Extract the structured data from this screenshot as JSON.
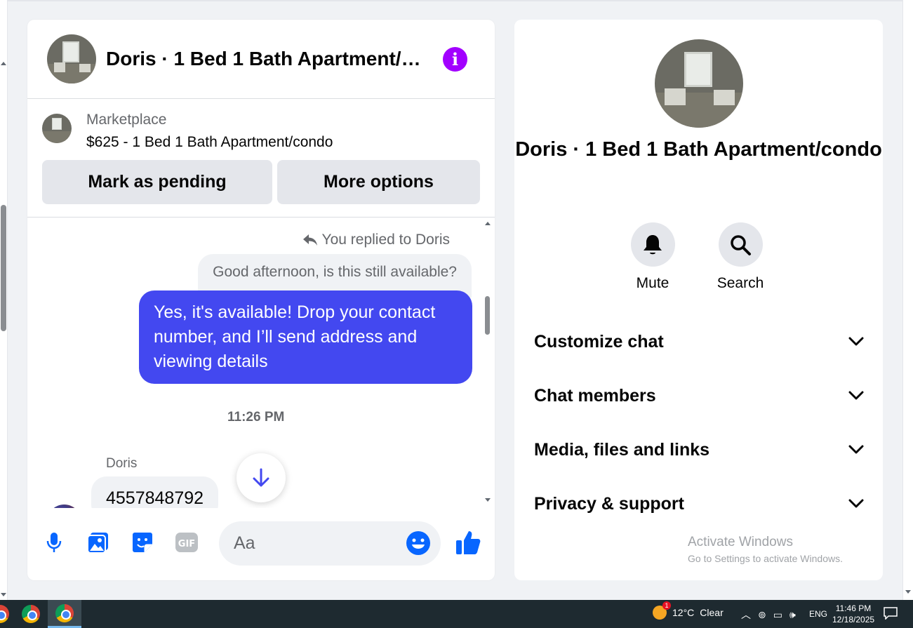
{
  "chat": {
    "title": "Doris · 1 Bed 1 Bath Apartment/condo",
    "marketplace": {
      "label": "Marketplace",
      "listing": "$625 - 1 Bed 1 Bath Apartment/condo",
      "mark_pending": "Mark as pending",
      "more_options": "More options"
    },
    "messages": {
      "replied_note": "You replied to Doris",
      "quoted": "Good afternoon, is this still available?",
      "mine": "Yes, it's available! Drop your contact number, and I’ll send address and viewing details",
      "timestamp": "11:26 PM",
      "sender": "Doris",
      "theirs": "4557848792"
    },
    "composer": {
      "placeholder": "Aa",
      "icons": [
        "microphone-icon",
        "photo-icon",
        "sticker-icon",
        "gif-icon",
        "emoji-icon",
        "thumbs-up-icon"
      ]
    },
    "accent_color": "#4348f0",
    "brand_color": "#0866ff"
  },
  "info": {
    "name": "Doris · 1 Bed 1 Bath Apartment/condo",
    "actions": {
      "mute": "Mute",
      "search": "Search"
    },
    "sections": [
      "Customize chat",
      "Chat members",
      "Media, files and links",
      "Privacy & support"
    ],
    "watermark": {
      "line1": "Activate Windows",
      "line2": "Go to Settings to activate Windows."
    }
  },
  "taskbar": {
    "weather": {
      "temp": "12°C",
      "condition": "Clear",
      "badge": "1"
    },
    "language": "ENG",
    "time": "11:46 PM",
    "date": "12/18/2025"
  }
}
